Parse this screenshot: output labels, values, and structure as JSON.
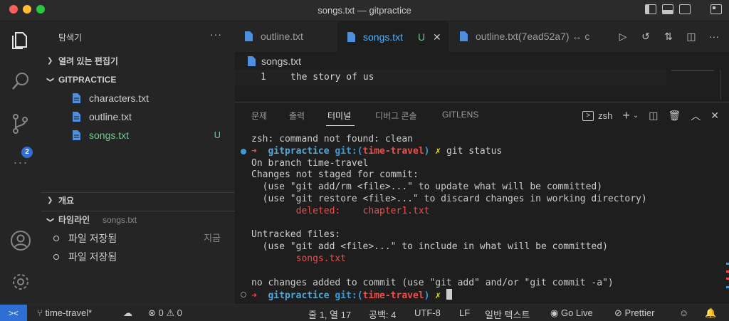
{
  "window": {
    "title": "songs.txt — gitpractice",
    "traffic_colors": [
      "#ff5f57",
      "#febc2e",
      "#28c840"
    ]
  },
  "activity_bar": {
    "items": [
      "files-icon",
      "search-icon",
      "source-control-icon",
      "more-icon"
    ],
    "scm_badge": "2",
    "bottom": [
      "account-icon",
      "settings-icon"
    ]
  },
  "sidebar": {
    "header": "탐색기",
    "open_editors": "열려 있는 편집기",
    "project": "GITPRACTICE",
    "files": [
      {
        "name": "characters.txt",
        "status": ""
      },
      {
        "name": "outline.txt",
        "status": ""
      },
      {
        "name": "songs.txt",
        "status": "U"
      }
    ],
    "outline_section": "개요",
    "timeline_section": "타임라인",
    "timeline_file": "songs.txt",
    "timeline": [
      {
        "label": "파일 저장됨",
        "time": "지금"
      },
      {
        "label": "파일 저장됨",
        "time": ""
      }
    ]
  },
  "tabs": [
    {
      "label": "outline.txt",
      "modified": "",
      "active": false
    },
    {
      "label": "songs.txt",
      "modified": "U",
      "active": true
    },
    {
      "label": "outline.txt(7ead52a7) ↔ c",
      "modified": "",
      "active": false
    }
  ],
  "editor": {
    "breadcrumb": "songs.txt",
    "lines": [
      {
        "num": "1",
        "text": "the story of us"
      }
    ]
  },
  "panel": {
    "tabs": [
      "문제",
      "출력",
      "터미널",
      "디버그 콘솔",
      "GITLENS"
    ],
    "active_tab": "터미널",
    "shell": "zsh",
    "terminal": {
      "l1": "zsh: command not found: clean",
      "prompt_arrow": "➜",
      "prompt_repo": "gitpractice",
      "prompt_git": "git:(",
      "prompt_branch": "time-travel",
      "prompt_close": ")",
      "prompt_x": "✗",
      "cmd": " git status",
      "l3": "On branch time-travel",
      "l4": "Changes not staged for commit:",
      "l5": "  (use \"git add/rm <file>...\" to update what will be committed)",
      "l6": "  (use \"git restore <file>...\" to discard changes in working directory)",
      "l7a": "        deleted:    ",
      "l7b": "chapter1.txt",
      "l9": "Untracked files:",
      "l10": "  (use \"git add <file>...\" to include in what will be committed)",
      "l11": "        songs.txt",
      "l13": "no changes added to commit (use \"git add\" and/or \"git commit -a\")"
    }
  },
  "statusbar": {
    "remote": "><",
    "branch": "time-travel*",
    "problems": "⊗ 0 ⚠ 0",
    "position": "줄 1, 열 17",
    "spaces": "공백: 4",
    "encoding": "UTF-8",
    "eol": "LF",
    "language": "일반 텍스트",
    "golive": "Go Live",
    "prettier": "Prettier"
  }
}
